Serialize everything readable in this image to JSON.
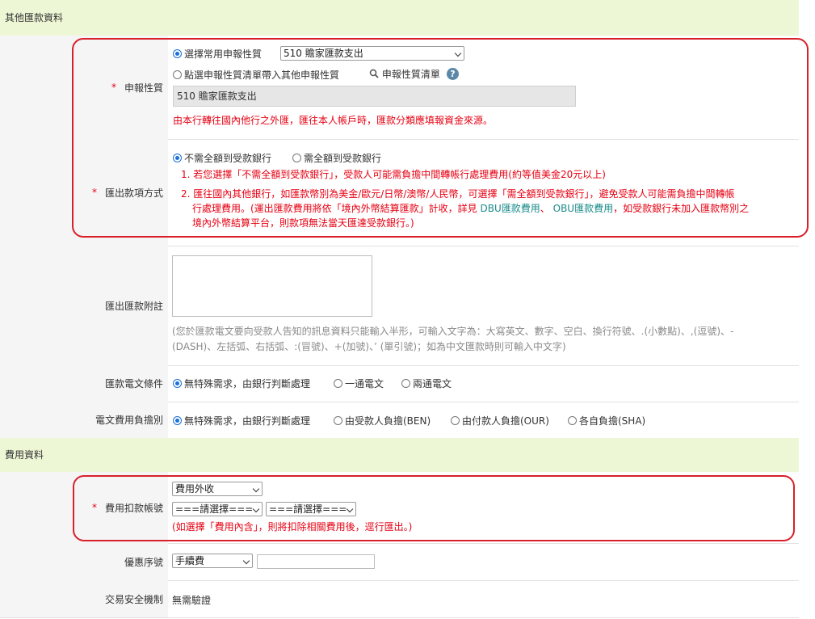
{
  "sections": {
    "other": "其他匯款資料",
    "fee": "費用資料"
  },
  "declaration": {
    "label": "申報性質",
    "required_mark": "*",
    "option_common": "選擇常用申報性質",
    "selected_value": "510 贍家匯款支出",
    "option_list": "點選申報性質清單帶入其他申報性質",
    "list_link": "申報性質清單",
    "help_icon_text": "?",
    "display_value": "510 贍家匯款支出",
    "note": "由本行轉往國內他行之外匯，匯往本人帳戶時，匯款分類應填報資金來源。"
  },
  "payment_method": {
    "label": "匯出款項方式",
    "required_mark": "*",
    "option_no_full": "不需全額到受款銀行",
    "option_full": "需全額到受款銀行",
    "note1": "1. 若您選擇「不需全額到受款銀行」，受款人可能需負擔中間轉帳行處理費用(約等值美金20元以上)",
    "note2_a": "2. 匯往國內其他銀行，如匯款幣別為美金/歐元/日幣/澳幣/人民幣，可選擇「需全額到受款銀行」，避免受款人可能需負擔中間轉帳",
    "note2_b": "行處理費用。(運出匯款費用將依「境內外幣結算匯款」計收，詳見",
    "note2_link1": "DBU匯款費用",
    "note2_sep": "、",
    "note2_link2": "OBU匯款費用",
    "note2_c": "，如受款銀行未加入匯款幣別之",
    "note2_d": "境內外幣結算平台，則款項無法當天匯達受款銀行。)"
  },
  "remittance_note": {
    "label": "匯出匯款附註",
    "hint1": "(您於匯款電文要向受款人告知的訊息資料只能輸入半形，可輸入文字為：大寫英文、數字、空白、換行符號、.(小數點)、,(逗號)、-",
    "hint2": "(DASH)、左括弧、右括弧、:(冒號)、+(加號)、’ (單引號)；如為中文匯款時則可輸入中文字)"
  },
  "telegram": {
    "label": "匯款電文條件",
    "opt1": "無特殊需求，由銀行判斷處理",
    "opt2": "一通電文",
    "opt3": "兩通電文"
  },
  "fee_bearer": {
    "label": "電文費用負擔別",
    "opt1": "無特殊需求，由銀行判斷處理",
    "opt2": "由受款人負擔(BEN)",
    "opt3": "由付款人負擔(OUR)",
    "opt4": "各自負擔(SHA)"
  },
  "fee_account": {
    "label": "費用扣款帳號",
    "required_mark": "*",
    "select1": "費用外收",
    "select2": "===請選擇===",
    "select3": "===請選擇===",
    "note": "(如選擇「費用內含」，則將扣除相關費用後，逕行匯出。)"
  },
  "discount": {
    "label": "優惠序號",
    "select": "手續費",
    "input_value": ""
  },
  "security": {
    "label": "交易安全機制",
    "value": "無需驗證"
  },
  "colors": {
    "header_bg": "#eef7d5",
    "label_bg": "#f5f5f5",
    "required": "#e60012",
    "annotation": "#d9202a",
    "link": "#1a8a8a"
  }
}
